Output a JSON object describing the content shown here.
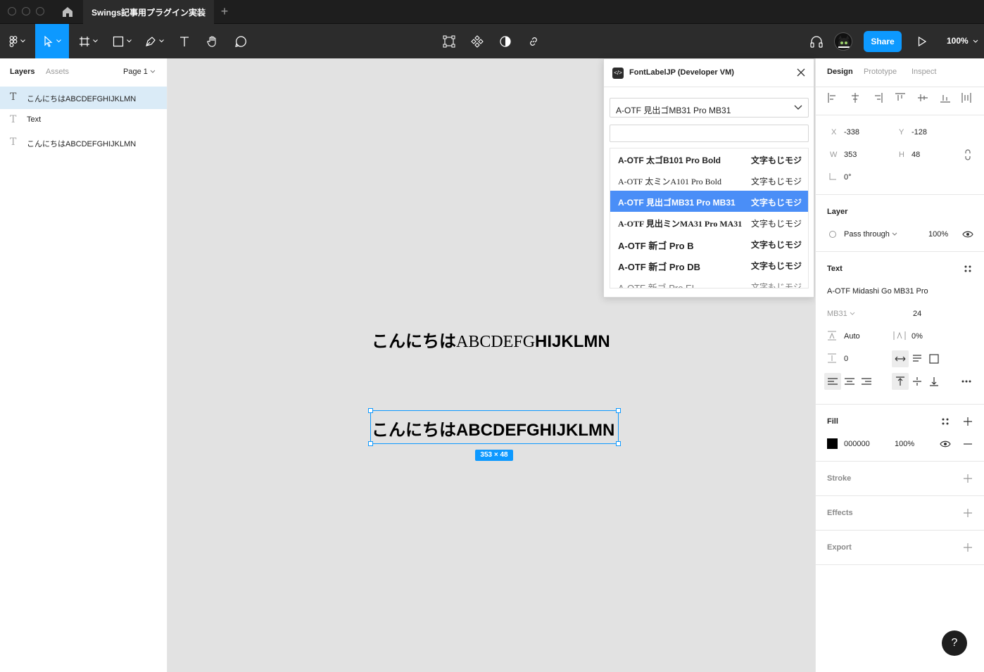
{
  "titlebar": {
    "tab_title": "Swings記事用プラグイン実装",
    "new_tab": "+"
  },
  "toolbar": {
    "share_label": "Share",
    "zoom_label": "100%"
  },
  "left_panel": {
    "tabs": [
      "Layers",
      "Assets"
    ],
    "page_label": "Page 1",
    "layers": [
      {
        "label": "こんにちはABCDEFGHIJKLMN",
        "selected": true
      },
      {
        "label": "Text",
        "selected": false
      },
      {
        "label": "こんにちはABCDEFGHIJKLMN",
        "selected": false
      }
    ]
  },
  "canvas": {
    "text_1": {
      "jp": "こんにちは",
      "serif": "ABCDEFG",
      "bold": "HIJKLMN"
    },
    "text_2": "こんにちはABCDEFGHIJKLMN",
    "size_badge": "353 × 48"
  },
  "plugin": {
    "title": "FontLabelJP (Developer VM)",
    "selected_font": "A-OTF 見出ゴMB31 Pro MB31",
    "search_value": "",
    "fonts": [
      {
        "name": "A-OTF 太ゴB101 Pro Bold",
        "sample": "文字もじモジ",
        "selected": false
      },
      {
        "name": "A-OTF 太ミンA101 Pro Bold",
        "sample": "文字もじモジ",
        "selected": false
      },
      {
        "name": "A-OTF 見出ゴMB31 Pro MB31",
        "sample": "文字もじモジ",
        "selected": true
      },
      {
        "name": "A-OTF 見出ミンMA31 Pro MA31",
        "sample": "文字もじモジ",
        "selected": false
      },
      {
        "name": "A-OTF 新ゴ Pro B",
        "sample": "文字もじモジ",
        "selected": false
      },
      {
        "name": "A-OTF 新ゴ Pro DB",
        "sample": "文字もじモジ",
        "selected": false
      },
      {
        "name": "A-OTF 新ゴ Pro EL",
        "sample": "文字もじモジ",
        "selected": false
      }
    ]
  },
  "right_panel": {
    "tabs": [
      "Design",
      "Prototype",
      "Inspect"
    ],
    "x_label": "X",
    "x_value": "-338",
    "y_label": "Y",
    "y_value": "-128",
    "w_label": "W",
    "w_value": "353",
    "h_label": "H",
    "h_value": "48",
    "rotation_value": "0°",
    "layer": {
      "title": "Layer",
      "blend_mode": "Pass through",
      "opacity": "100%"
    },
    "text": {
      "title": "Text",
      "font_family": "A-OTF Midashi Go MB31 Pro",
      "font_style": "MB31",
      "font_size": "24",
      "line_height": "Auto",
      "letter_spacing": "0%",
      "paragraph_spacing": "0"
    },
    "fill": {
      "title": "Fill",
      "hex": "000000",
      "opacity": "100%",
      "color": "#000000"
    },
    "stroke_title": "Stroke",
    "effects_title": "Effects",
    "export_title": "Export"
  },
  "help_label": "?",
  "colors": {
    "accent": "#0d99ff",
    "plugin_selected": "#4a8ef7",
    "toolbar": "#2c2c2c"
  }
}
